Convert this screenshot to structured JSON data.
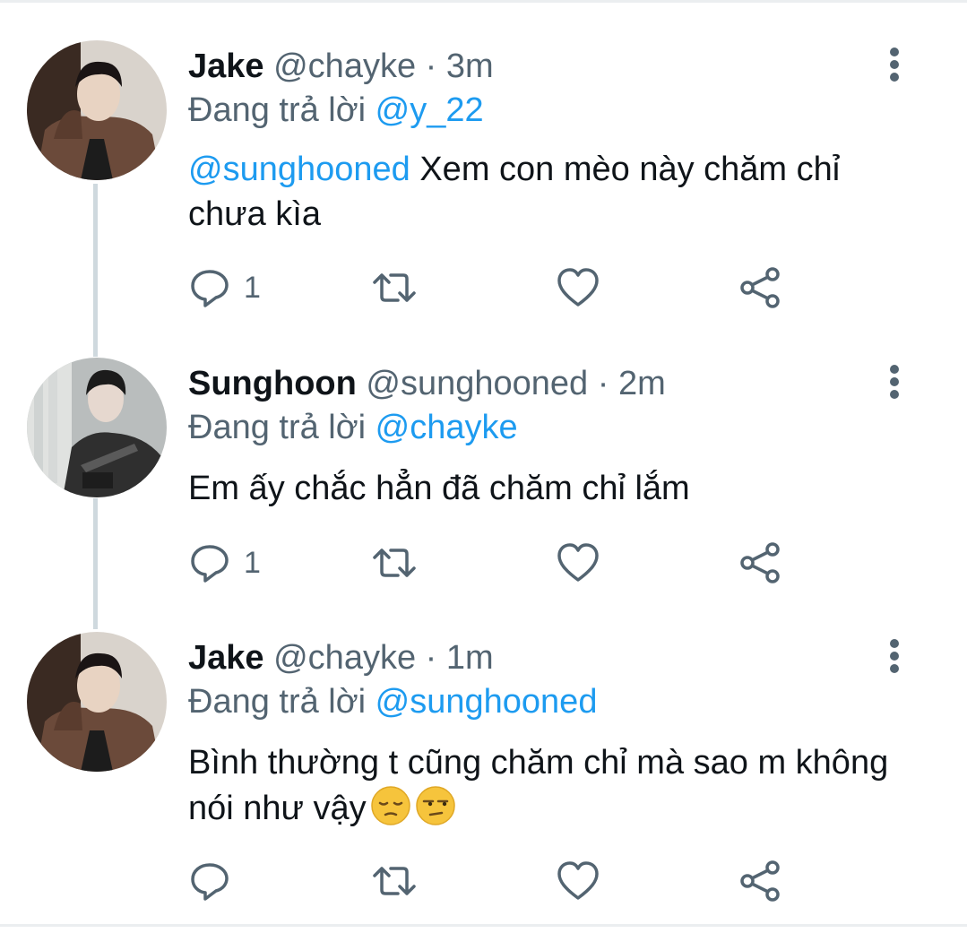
{
  "colors": {
    "link": "#1d9bf0",
    "text": "#0f1419",
    "muted": "#536471",
    "thread": "#cfd9de"
  },
  "tweets": [
    {
      "name": "Jake",
      "handle": "@chayke",
      "time": "3m",
      "reply_prefix": "Đang trả lời",
      "reply_to": "@y_22",
      "mention": "@sunghooned",
      "text": " Xem con mèo này chăm chỉ chưa kìa",
      "reply_count": "1",
      "avatar_icon": "avatar-photo"
    },
    {
      "name": "Sunghoon",
      "handle": "@sunghooned",
      "time": "2m",
      "reply_prefix": "Đang trả lời",
      "reply_to": "@chayke",
      "mention": "",
      "text": "Em ấy chắc hẳn đã chăm chỉ lắm",
      "reply_count": "1",
      "avatar_icon": "avatar-photo"
    },
    {
      "name": "Jake",
      "handle": "@chayke",
      "time": "1m",
      "reply_prefix": "Đang trả lời",
      "reply_to": "@sunghooned",
      "mention": "",
      "text": "Bình thường t cũng chăm chỉ mà sao m không nói như vậy",
      "emojis": [
        "pensive-face",
        "unamused-face"
      ],
      "reply_count": "",
      "avatar_icon": "avatar-photo"
    }
  ],
  "icons": [
    "reply-icon",
    "retweet-icon",
    "like-icon",
    "share-icon",
    "more-icon"
  ]
}
